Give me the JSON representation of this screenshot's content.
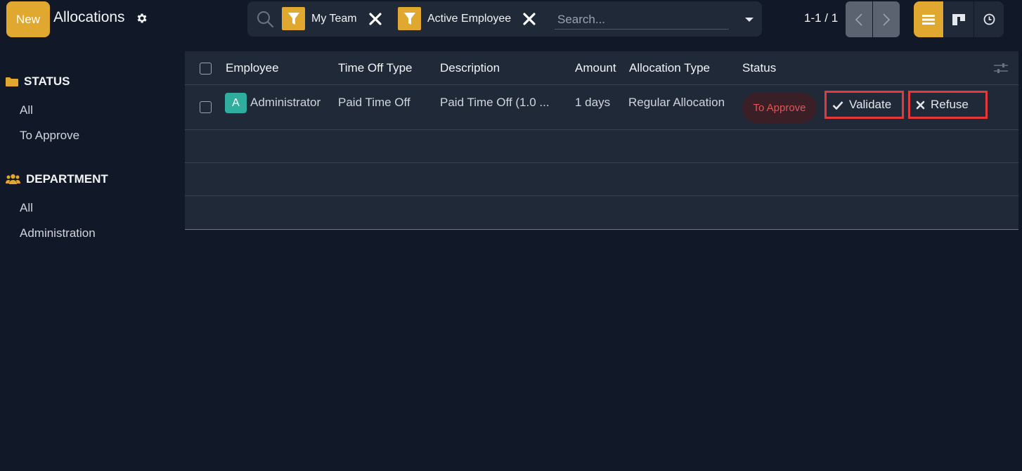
{
  "control_panel": {
    "new_label": "New",
    "title": "Allocations",
    "search": {
      "facets": [
        {
          "label": "My Team",
          "icon": "filter-icon"
        },
        {
          "label": "Active Employee",
          "icon": "filter-icon"
        }
      ],
      "placeholder": "Search..."
    },
    "pager": {
      "value": "1-1 / 1"
    },
    "views": [
      "list",
      "kanban",
      "activity"
    ],
    "active_view": "list"
  },
  "sidebar": {
    "status": {
      "heading": "STATUS",
      "items": [
        "All",
        "To Approve"
      ]
    },
    "department": {
      "heading": "DEPARTMENT",
      "items": [
        "All",
        "Administration"
      ]
    }
  },
  "list": {
    "columns": [
      "Employee",
      "Time Off Type",
      "Description",
      "Amount",
      "Allocation Type",
      "Status"
    ],
    "rows": [
      {
        "avatar_letter": "A",
        "employee": "Administrator",
        "time_off_type": "Paid Time Off",
        "description": "Paid Time Off (1.0 ...",
        "amount": "1 days",
        "allocation_type": "Regular Allocation",
        "status": "To Approve",
        "actions": {
          "validate": "Validate",
          "refuse": "Refuse"
        }
      }
    ]
  },
  "colors": {
    "background": "#111827",
    "panel": "#1f2937",
    "accent": "#e0a82e",
    "status_red": "#e05656",
    "highlight_red": "#e5383b",
    "avatar": "#2fae9f"
  }
}
